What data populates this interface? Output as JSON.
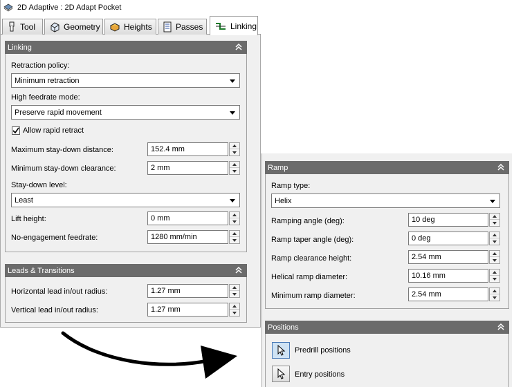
{
  "window": {
    "title": "2D Adaptive : 2D Adapt Pocket"
  },
  "tabs": [
    {
      "label": "Tool",
      "icon": "tool-icon"
    },
    {
      "label": "Geometry",
      "icon": "geometry-icon"
    },
    {
      "label": "Heights",
      "icon": "heights-icon"
    },
    {
      "label": "Passes",
      "icon": "passes-icon"
    },
    {
      "label": "Linking",
      "icon": "linking-icon",
      "active": true
    }
  ],
  "linking": {
    "header": "Linking",
    "retraction_policy": {
      "label": "Retraction policy:",
      "value": "Minimum retraction"
    },
    "high_feedrate_mode": {
      "label": "High feedrate mode:",
      "value": "Preserve rapid movement"
    },
    "allow_rapid_retract": {
      "label": "Allow rapid retract",
      "checked": true
    },
    "max_stay_down": {
      "label": "Maximum stay-down distance:",
      "value": "152.4 mm"
    },
    "min_stay_down_clearance": {
      "label": "Minimum stay-down clearance:",
      "value": "2 mm"
    },
    "stay_down_level": {
      "label": "Stay-down level:",
      "value": "Least"
    },
    "lift_height": {
      "label": "Lift height:",
      "value": "0 mm"
    },
    "no_engagement_feedrate": {
      "label": "No-engagement feedrate:",
      "value": "1280 mm/min"
    }
  },
  "leads": {
    "header": "Leads & Transitions",
    "horizontal_lead": {
      "label": "Horizontal lead in/out radius:",
      "value": "1.27 mm"
    },
    "vertical_lead": {
      "label": "Vertical lead in/out radius:",
      "value": "1.27 mm"
    }
  },
  "ramp": {
    "header": "Ramp",
    "ramp_type": {
      "label": "Ramp type:",
      "value": "Helix"
    },
    "ramping_angle": {
      "label": "Ramping angle (deg):",
      "value": "10 deg"
    },
    "ramp_taper_angle": {
      "label": "Ramp taper angle (deg):",
      "value": "0 deg"
    },
    "ramp_clearance_height": {
      "label": "Ramp clearance height:",
      "value": "2.54 mm"
    },
    "helical_ramp_diameter": {
      "label": "Helical ramp diameter:",
      "value": "10.16 mm"
    },
    "min_ramp_diameter": {
      "label": "Minimum ramp diameter:",
      "value": "2.54 mm"
    }
  },
  "positions": {
    "header": "Positions",
    "predrill": {
      "label": "Predrill positions",
      "pressed": true
    },
    "entry": {
      "label": "Entry positions",
      "pressed": false
    }
  },
  "colors": {
    "panel_header": "#6b6b6b",
    "background": "#f0f0f0",
    "accent": "#4a7bb7"
  }
}
